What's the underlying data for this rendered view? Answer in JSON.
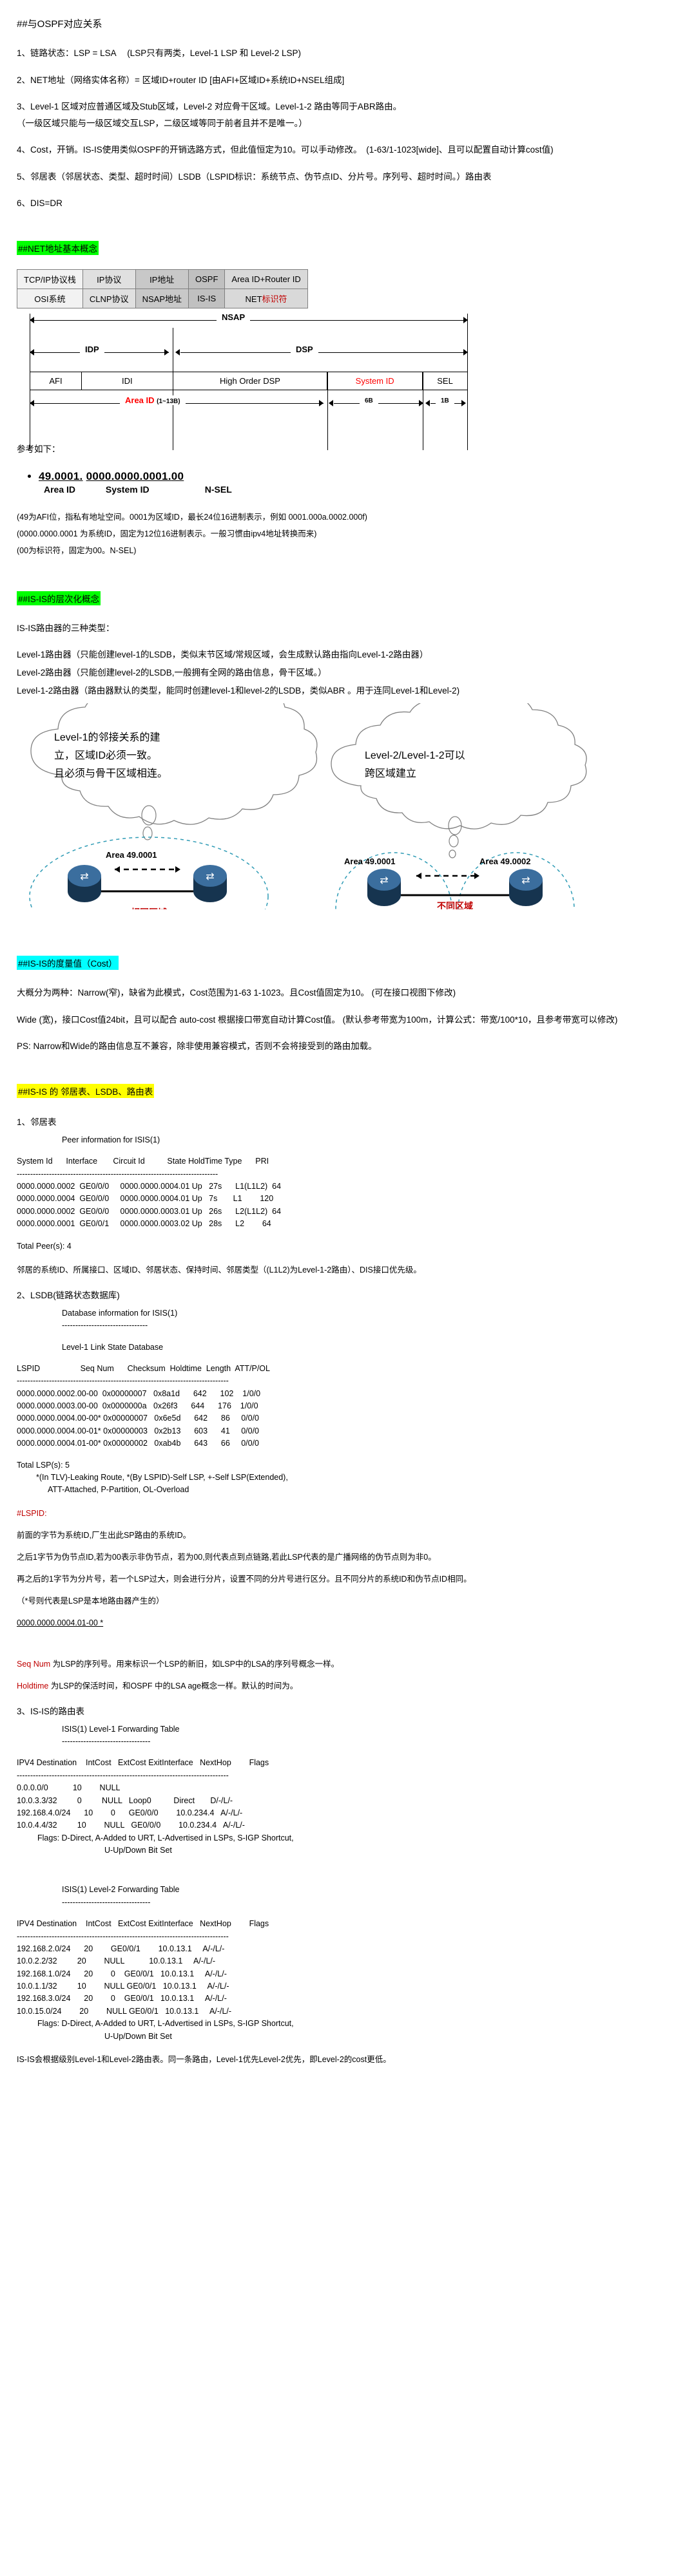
{
  "sections": {
    "ospf_heading": "##与OSPF对应关系",
    "items": [
      "1、链路状态：LSP = LSA 　(LSP只有两类，Level-1 LSP 和 Level-2 LSP)",
      "2、NET地址（网络实体名称）= 区域ID+router ID [由AFI+区域ID+系统ID+NSEL组成]",
      "3、Level-1 区域对应普通区域及Stub区域，Level-2 对应骨干区域。Level-1-2 路由等同于ABR路由。",
      "（一级区域只能与一级区域交互LSP，二级区域等同于前者且并不是唯一。）",
      "4、Cost，开销。IS-IS使用类似OSPF的开销选路方式，但此值恒定为10。可以手动修改。　(1-63/1-1023[wide]、且可以配置自动计算cost值)",
      "5、邻居表（邻居状态、类型、超时时间）LSDB（LSPID标识：系统节点、伪节点ID、分片号。序列号、超时时间。）路由表",
      "6、DIS=DR"
    ],
    "net_heading": "##NET地址基本概念"
  },
  "stack_table": {
    "rows": [
      [
        "TCP/IP协议栈",
        "IP协议",
        "IP地址",
        "OSPF",
        "Area ID+Router ID"
      ],
      [
        "OSI系统",
        "CLNP协议",
        "NSAP地址",
        "IS-IS",
        "NET标识符"
      ]
    ],
    "net_prefix": "NET",
    "net_suffix": "标识符"
  },
  "nsap_diagram": {
    "top_label": "NSAP",
    "idp_label": "IDP",
    "dsp_label": "DSP",
    "fields": [
      "AFI",
      "IDI",
      "High Order DSP",
      "System ID",
      "SEL"
    ],
    "area_id_label": "Area ID",
    "area_id_size": "(1~13B)",
    "system_id_size": "6B",
    "sel_size": "1B"
  },
  "net_example": {
    "intro": "参考如下：",
    "address_part1": "49.0001.",
    "address_part2": "0000.0000.0001.",
    "address_part3": "00",
    "label_area": "Area ID",
    "label_system": "System ID",
    "label_nsel": "N-SEL",
    "notes": [
      "(49为AFI位，指私有地址空间。0001为区域ID，最长24位16进制表示，例如 0001.000a.0002.000f)",
      "(0000.0000.0001 为系统ID，固定为12位16进制表示。一般习惯由ipv4地址转换而来)",
      "(00为标识符，固定为00。N-SEL)"
    ]
  },
  "hierarchy": {
    "heading": "##IS-IS的层次化概念",
    "intro": "IS-IS路由器的三种类型：",
    "types": [
      "Level-1路由器（只能创建level-1的LSDB，类似末节区域/常规区域，会生成默认路由指向Level-1-2路由器）",
      "Level-2路由器（只能创建level-2的LSDB,一般拥有全网的路由信息，骨干区域。）",
      "Level-1-2路由器（路由器默认的类型，能同时创建level-1和level-2的LSDB，类似ABR 。用于连同Level-1和Level-2)"
    ]
  },
  "cloud_diagram": {
    "cloud_left": "Level-1的邻接关系的建立，区域ID必须一致。且必须与骨干区域相连。",
    "cloud_right": "Level-2/Level-1-2可以跨区域建立",
    "left_area": "Area 49.0001",
    "left_caption": "相同区域",
    "right_area_1": "Area 49.0001",
    "right_area_2": "Area 49.0002",
    "right_caption": "不同区域"
  },
  "cost": {
    "heading": "##IS-IS的度量值（Cost）",
    "narrow": "大概分为两种：Narrow(窄)，缺省为此模式，Cost范围为1-63 1-1023。且Cost值固定为10。 (可在接口视图下修改)",
    "wide": "Wide (宽)，接口Cost值24bit，且可以配合 auto-cost 根据接口带宽自动计算Cost值。 (默认参考带宽为100m，计算公式：带宽/100*10，且参考带宽可以修改)",
    "ps": "PS: Narrow和Wide的路由信息互不兼容，除非使用兼容模式，否则不会将接受到的路由加载。"
  },
  "tables_section": {
    "heading": "##IS-IS 的 邻居表、LSDB、路由表",
    "peer": {
      "num": "1、邻居表",
      "title": "Peer information for ISIS(1)",
      "headers": "System Id      Interface       Circuit Id          State HoldTime Type      PRI",
      "divider": "---------------------------------------------------------------------------",
      "rows": [
        "0000.0000.0002  GE0/0/0     0000.0000.0004.01 Up   27s      L1(L1L2)  64",
        "0000.0000.0004  GE0/0/0     0000.0000.0004.01 Up   7s       L1        120",
        "0000.0000.0002  GE0/0/0     0000.0000.0003.01 Up   26s      L2(L1L2)  64",
        "0000.0000.0001  GE0/0/1     0000.0000.0003.02 Up   28s      L2        64"
      ],
      "total": "Total Peer(s): 4",
      "note": "邻居的系统ID、所属接口、区域ID、邻居状态、保持时间、邻居类型（(L1L2)为Level-1-2路由）、DIS接口优先级。"
    },
    "lsdb": {
      "num": "2、LSDB(链路状态数据库)",
      "title": "Database information for ISIS(1)",
      "title_divider": "--------------------------------",
      "subtitle": "Level-1 Link State Database",
      "headers": "LSPID                  Seq Num      Checksum  Holdtime  Length  ATT/P/OL",
      "divider": "-------------------------------------------------------------------------------",
      "rows": [
        "0000.0000.0002.00-00  0x00000007   0x8a1d      642      102    1/0/0",
        "0000.0000.0003.00-00  0x0000000a   0x26f3      644      176    1/0/0",
        "0000.0000.0004.00-00* 0x00000007   0x6e5d      642      86     0/0/0",
        "0000.0000.0004.00-01* 0x00000003   0x2b13      603      41     0/0/0",
        "0000.0000.0004.01-00* 0x00000002   0xab4b      643      66     0/0/0"
      ],
      "total": "Total LSP(s): 5",
      "legend1": "*(In TLV)-Leaking Route, *(By LSPID)-Self LSP, +-Self LSP(Extended),",
      "legend2": "ATT-Attached, P-Partition, OL-Overload",
      "lspid_label": "#LSPID:",
      "para1": "前面的字节为系统ID,厂生出此SP路由的系统ID。",
      "para2": "之后1字节为伪节点ID,若为00表示非伪节点，若为00,则代表点到点链路,若此LSP代表的是广播网络的伪节点则为非0。",
      "para3": "再之后的1字节为分片号，若一个LSP过大，则会进行分片，设置不同的分片号进行区分。且不同分片的系统ID和伪节点ID相同。",
      "para4": "（*号则代表是LSP是本地路由器产生的）",
      "example": "0000.0000.0004.01-00 *",
      "seq_label": "Seq Num",
      "seq_text": "为LSP的序列号。用来标识一个LSP的新旧，如LSP中的LSA的序列号概念一样。",
      "hold_label": "Holdtime",
      "hold_text": "为LSP的保活时间，和OSPF 中的LSA age概念一样。默认的时间为。"
    },
    "routing": {
      "num": "3、IS-IS的路由表",
      "l1_title": "ISIS(1) Level-1 Forwarding Table",
      "l1_divider": "---------------------------------",
      "headers": "IPV4 Destination    IntCost   ExtCost ExitInterface   NextHop        Flags",
      "divider": "-------------------------------------------------------------------------------",
      "l1_rows": [
        "0.0.0.0/0           10        NULL",
        "10.0.3.3/32         0         NULL   Loop0          Direct       D/-/L/-",
        "192.168.4.0/24      10        0      GE0/0/0        10.0.234.4   A/-/L/-",
        "10.0.4.4/32         10        NULL   GE0/0/0        10.0.234.4   A/-/L/-"
      ],
      "flags_line1": "Flags: D-Direct, A-Added to URT, L-Advertised in LSPs, S-IGP Shortcut,",
      "flags_line2": "U-Up/Down Bit Set",
      "l2_title": "ISIS(1) Level-2 Forwarding Table",
      "l2_divider": "---------------------------------",
      "l2_rows": [
        "192.168.2.0/24      20        GE0/0/1        10.0.13.1     A/-/L/-",
        "10.0.2.2/32         20        NULL           10.0.13.1     A/-/L/-",
        "192.168.1.0/24      20        0    GE0/0/1   10.0.13.1     A/-/L/-",
        "10.0.1.1/32         10        NULL GE0/0/1   10.0.13.1     A/-/L/-",
        "192.168.3.0/24      20        0    GE0/0/1   10.0.13.1     A/-/L/-",
        "10.0.15.0/24        20        NULL GE0/0/1   10.0.13.1     A/-/L/-"
      ],
      "footer": "IS-IS会根据级别Level-1和Level-2路由表。同一条路由，Level-1优先Level-2优先，即Level-2的cost更低。"
    }
  }
}
